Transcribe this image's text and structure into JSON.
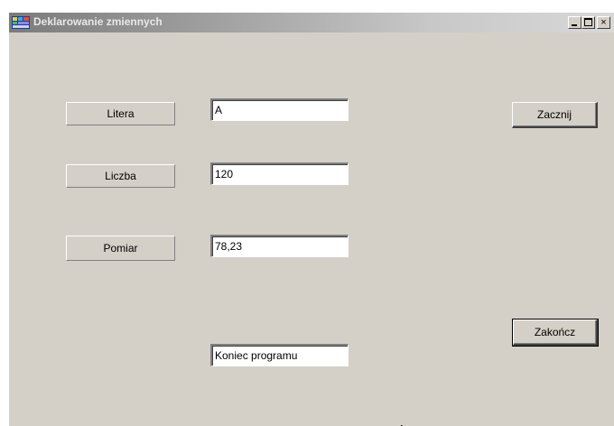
{
  "window": {
    "title": "Deklarowanie zmiennych",
    "controls": {
      "minimize": "minimize-icon",
      "maximize": "maximize-icon",
      "close": "×"
    }
  },
  "labels": {
    "litera": "Litera",
    "liczba": "Liczba",
    "pomiar": "Pomiar"
  },
  "fields": {
    "litera": "A",
    "liczba": "120",
    "pomiar": "78,23",
    "status": "Koniec programu"
  },
  "buttons": {
    "start": "Zacznij",
    "finish": "Zakończ"
  },
  "colors": {
    "window_bg": "#d4d0c8",
    "field_bg": "#ffffff"
  }
}
